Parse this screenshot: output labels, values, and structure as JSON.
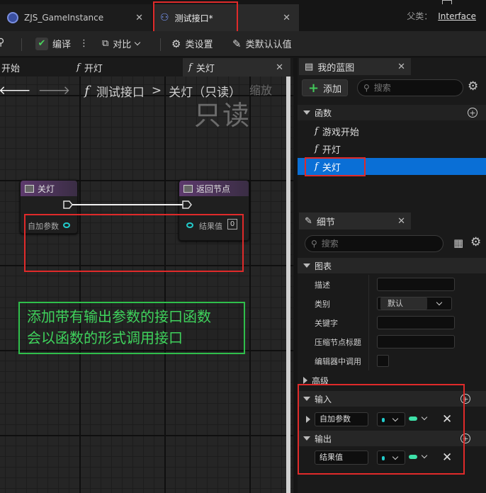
{
  "tabs": {
    "inactive": "ZJS_GameInstance",
    "active": "测试接口*",
    "parent_label": "父类：",
    "parent_value": "Interface"
  },
  "toolbar": {
    "compile": "编译",
    "diff": "对比",
    "class_settings": "类设置",
    "class_defaults": "类默认认值"
  },
  "graph_tabs": [
    "开始",
    "开灯",
    "关灯"
  ],
  "breadcrumb": {
    "root": "测试接口",
    "sep": ">",
    "current": "关灯（只读）",
    "zoom": "缩放"
  },
  "watermark": "只读",
  "nodes": {
    "entry": {
      "title": "关灯",
      "pin": "自加参数"
    },
    "return": {
      "title": "返回节点",
      "pin": "结果值",
      "value": "0"
    }
  },
  "annotation": "添加带有输出参数的接口函数\n会以函数的形式调用接口",
  "my_blueprint": {
    "title": "我的蓝图",
    "add": "添加",
    "search_placeholder": "搜索",
    "functions_label": "函数",
    "functions": [
      "游戏开始",
      "开灯",
      "关灯"
    ],
    "selected_index": 2
  },
  "details": {
    "title": "细节",
    "search_placeholder": "搜索",
    "graph_section": "图表",
    "fields": [
      "描述",
      "类别",
      "关键字",
      "压缩节点标题",
      "编辑器中调用"
    ],
    "category_value": "默认",
    "advanced": "高级",
    "inputs_label": "输入",
    "input_param": "自加参数",
    "outputs_label": "输出",
    "output_param": "结果值"
  },
  "colors": {
    "accent": "#0a6fd6",
    "highlight_box": "#e02a2a",
    "note_green": "#3fd35c",
    "pin_teal": "#2cc"
  }
}
